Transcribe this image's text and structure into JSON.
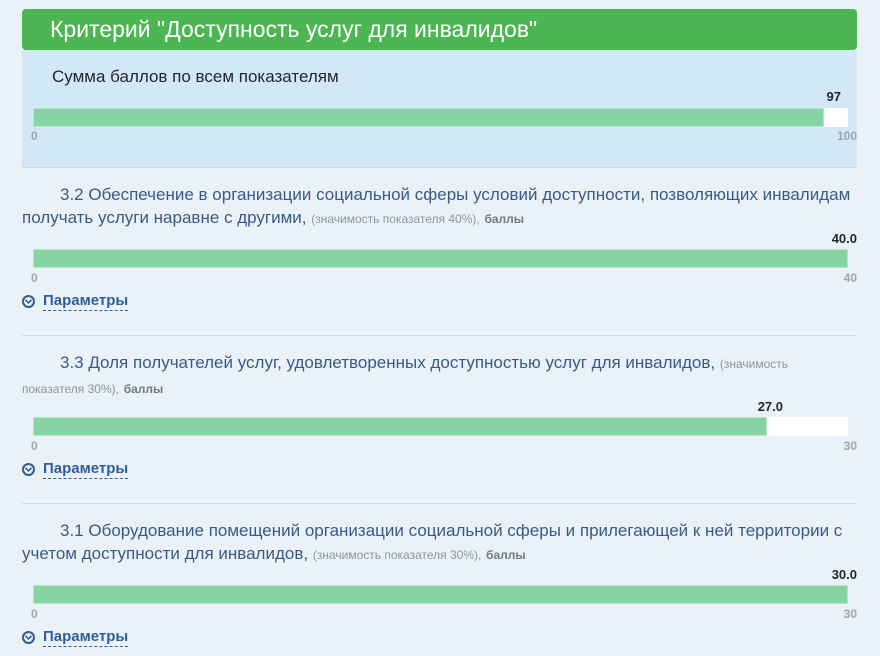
{
  "header": {
    "title": "Критерий \"Доступность услуг для инвалидов\""
  },
  "summary": {
    "caption": "Сумма баллов по всем показателям",
    "value": "97",
    "min_label": "0",
    "max_label": "100",
    "fill_fraction": 0.97
  },
  "indicators": [
    {
      "title": "3.2 Обеспечение в организации социальной сферы условий доступности, позволяющих инвалидам получать услуги наравне с другими,",
      "note": "(значимость показателя 40%),",
      "unit": "баллы",
      "value": "40.0",
      "min_label": "0",
      "max_label": "40",
      "fill_fraction": 1.0,
      "params_label": "Параметры"
    },
    {
      "title": "3.3 Доля получателей услуг, удовлетворенных доступностью услуг для инвалидов,",
      "note": "(значимость показателя 30%),",
      "unit": "баллы",
      "value": "27.0",
      "min_label": "0",
      "max_label": "30",
      "fill_fraction": 0.9,
      "params_label": "Параметры"
    },
    {
      "title": "3.1 Оборудование помещений организации социальной сферы и прилегающей к ней территории с учетом доступности для инвалидов,",
      "note": "(значимость показателя 30%),",
      "unit": "баллы",
      "value": "30.0",
      "min_label": "0",
      "max_label": "30",
      "fill_fraction": 1.0,
      "params_label": "Параметры"
    }
  ],
  "colors": {
    "header_bg": "#4cb653",
    "bar_fill": "#86d3a4",
    "summary_bg": "#d2e8f6",
    "link": "#2f5f96"
  },
  "icons": {
    "params_toggle": "chevron-down-circle-icon"
  }
}
